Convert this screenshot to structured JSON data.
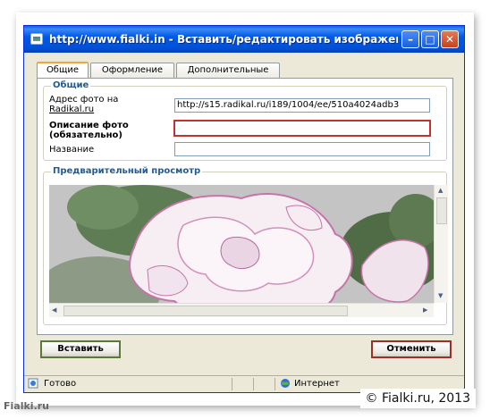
{
  "window": {
    "title": "http://www.fialki.in - Вставить/редактировать изображени...",
    "min_glyph": "–",
    "max_glyph": "□",
    "close_glyph": "✕"
  },
  "tabs": [
    {
      "label": "Общие",
      "active": true
    },
    {
      "label": "Оформление",
      "active": false
    },
    {
      "label": "Дополнительные",
      "active": false
    }
  ],
  "general": {
    "legend": "Общие",
    "url_label_line1": "Адрес фото на",
    "url_label_line2": "Radikal.ru",
    "url_value": "http://s15.radikal.ru/i189/1004/ee/510a4024adb3",
    "desc_label_line1": "Описание фото",
    "desc_label_line2": "(обязательно)",
    "desc_value": "",
    "name_label": "Название",
    "name_value": ""
  },
  "preview": {
    "legend": "Предварительный просмотр"
  },
  "buttons": {
    "insert": "Вставить",
    "cancel": "Отменить"
  },
  "status": {
    "left": "Готово",
    "zone": "Интернет"
  },
  "overlay": {
    "copyright": "© Fialki.ru, 2013",
    "site": "Fialki.ru"
  },
  "colors": {
    "title_bar": "#0058E6",
    "required_border": "#C0332E",
    "legend_text": "#1F5C99"
  }
}
